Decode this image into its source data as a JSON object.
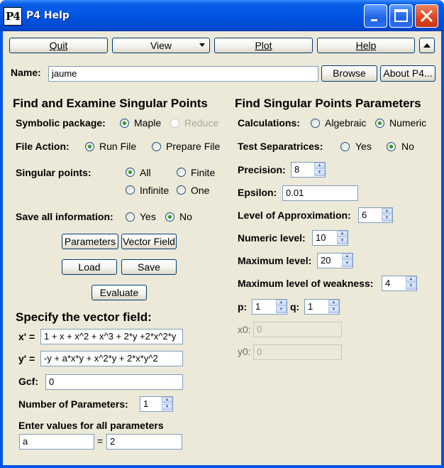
{
  "window": {
    "title": "P4 Help",
    "icon_text": "P4",
    "minimize_icon": "minimize-icon",
    "maximize_icon": "maximize-icon",
    "close_icon": "close-icon"
  },
  "toolbar": {
    "quit": "Quit",
    "view": "View",
    "plot": "Plot",
    "help": "Help"
  },
  "name_row": {
    "label": "Name:",
    "value": "jaume",
    "browse": "Browse",
    "about": "About P4..."
  },
  "left": {
    "heading": "Find and Examine Singular Points",
    "symbolic_package": {
      "label": "Symbolic package:",
      "options": [
        "Maple",
        "Reduce"
      ],
      "selected": "Maple"
    },
    "file_action": {
      "label": "File Action:",
      "options": [
        "Run File",
        "Prepare File"
      ],
      "selected": "Run File"
    },
    "singular_points": {
      "label": "Singular points:",
      "options": [
        "All",
        "Finite",
        "Infinite",
        "One"
      ],
      "selected": "All"
    },
    "save_info": {
      "label": "Save all information:",
      "options": [
        "Yes",
        "No"
      ],
      "selected": "No"
    },
    "buttons": {
      "parameters": "Parameters",
      "vector_field": "Vector Field",
      "load": "Load",
      "save": "Save",
      "evaluate": "Evaluate"
    },
    "vector_field_heading": "Specify the vector field:",
    "xprime_label": "x' =",
    "xprime_value": "1 + x + x^2 + x^3 + 2*y +2*x^2*y",
    "yprime_label": "y' =",
    "yprime_value": "-y + a*x*y + x^2*y + 2*x*y^2",
    "gcf_label": "Gcf:",
    "gcf_value": "0",
    "num_params_label": "Number of Parameters:",
    "num_params_value": "1",
    "enter_values_label": "Enter values for all parameters",
    "param_name": "a",
    "equals": "=",
    "param_value": "2"
  },
  "right": {
    "heading": "Find Singular Points Parameters",
    "calculations": {
      "label": "Calculations:",
      "options": [
        "Algebraic",
        "Numeric"
      ],
      "selected": "Numeric"
    },
    "test_separatrices": {
      "label": "Test Separatrices:",
      "options": [
        "Yes",
        "No"
      ],
      "selected": "No"
    },
    "precision": {
      "label": "Precision:",
      "value": "8"
    },
    "epsilon": {
      "label": "Epsilon:",
      "value": "0.01"
    },
    "level_approx": {
      "label": "Level of Approximation:",
      "value": "6"
    },
    "numeric_level": {
      "label": "Numeric level:",
      "value": "10"
    },
    "maximum_level": {
      "label": "Maximum level:",
      "value": "20"
    },
    "max_weakness": {
      "label": "Maximum level of weakness:",
      "value": "4"
    },
    "p": {
      "label": "p:",
      "value": "1"
    },
    "q": {
      "label": "q:",
      "value": "1"
    },
    "x0": {
      "label": "x0:",
      "value": "0"
    },
    "y0": {
      "label": "y0:",
      "value": "0"
    }
  }
}
